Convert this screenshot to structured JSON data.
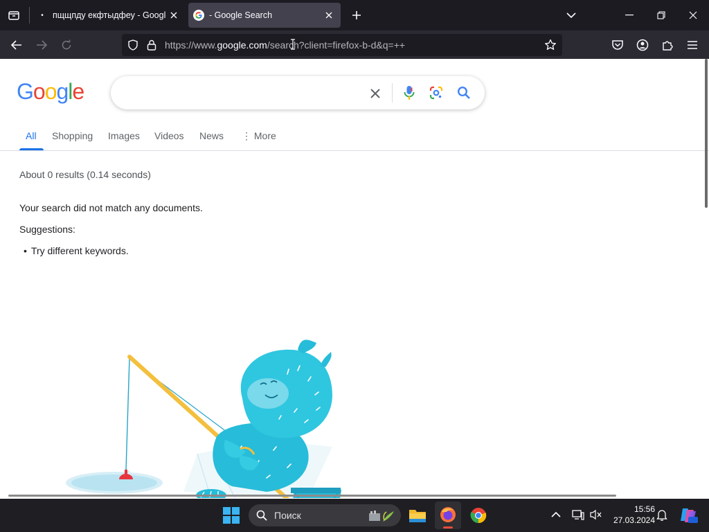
{
  "browser": {
    "tabs": [
      {
        "title": "пщщпду екфтыдфеу - Google",
        "active": false
      },
      {
        "title": "- Google Search",
        "active": true
      }
    ],
    "url": {
      "prefix": "https://www.",
      "domain": "google.com",
      "suffix": "/search?client=firefox-b-d&q=++"
    }
  },
  "google": {
    "logo": "Google",
    "search_value": "",
    "tabs": [
      "All",
      "Shopping",
      "Images",
      "Videos",
      "News",
      "More"
    ],
    "active_tab": "All",
    "stats": "About 0 results (0.14 seconds)",
    "no_match": "Your search did not match any documents.",
    "suggestions_label": "Suggestions:",
    "suggestions": [
      "Try different keywords."
    ]
  },
  "taskbar": {
    "search_placeholder": "Поиск",
    "time": "15:56",
    "date": "27.03.2024"
  },
  "colors": {
    "google_blue": "#4285F4",
    "google_red": "#EA4335",
    "google_yellow": "#FBBC05",
    "google_green": "#34A853",
    "active_tab_blue": "#1a73e8"
  }
}
